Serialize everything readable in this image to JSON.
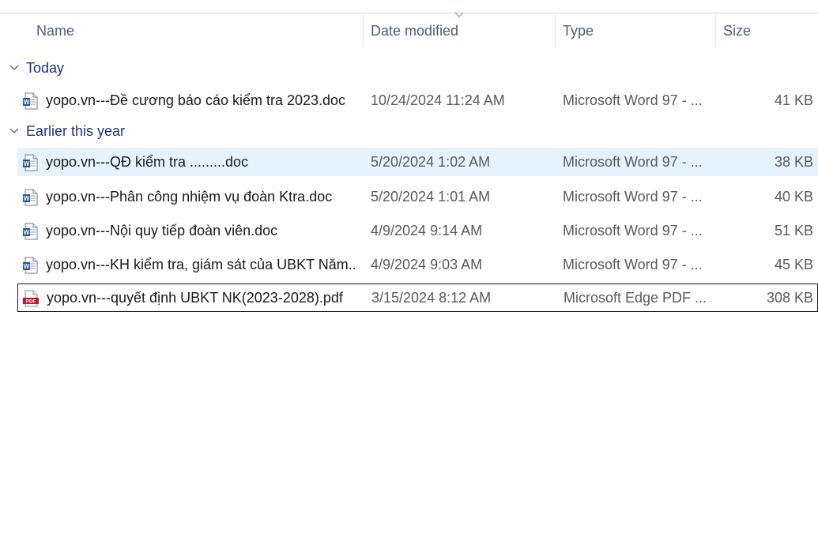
{
  "columns": {
    "name": "Name",
    "date_modified": "Date modified",
    "type": "Type",
    "size": "Size"
  },
  "groups": [
    {
      "label": "Today",
      "files": [
        {
          "name": "yopo.vn---Đề cương báo cáo kiểm tra 2023.doc",
          "date": "10/24/2024 11:24 AM",
          "type": "Microsoft Word 97 - ...",
          "size": "41 KB",
          "icon": "word-doc-icon"
        }
      ]
    },
    {
      "label": "Earlier this year",
      "files": [
        {
          "name": "yopo.vn---QĐ kiểm tra .........doc",
          "date": "5/20/2024 1:02 AM",
          "type": "Microsoft Word 97 - ...",
          "size": "38 KB",
          "icon": "word-doc-icon"
        },
        {
          "name": "yopo.vn---Phân công nhiệm vụ đoàn Ktra.doc",
          "date": "5/20/2024 1:01 AM",
          "type": "Microsoft Word 97 - ...",
          "size": "40 KB",
          "icon": "word-doc-icon"
        },
        {
          "name": "yopo.vn---Nội quy tiếp đoàn viên.doc",
          "date": "4/9/2024 9:14 AM",
          "type": "Microsoft Word 97 - ...",
          "size": "51 KB",
          "icon": "word-doc-icon"
        },
        {
          "name": "yopo.vn---KH kiểm tra, giám sát của UBKT Năm...",
          "date": "4/9/2024 9:03 AM",
          "type": "Microsoft Word 97 - ...",
          "size": "45 KB",
          "icon": "word-doc-icon"
        },
        {
          "name": "yopo.vn---quyết định UBKT NK(2023-2028).pdf",
          "date": "3/15/2024 8:12 AM",
          "type": "Microsoft Edge PDF ...",
          "size": "308 KB",
          "icon": "pdf-icon"
        }
      ]
    }
  ],
  "colors": {
    "header_text": "#4c607a",
    "group_text": "#1e3287",
    "selected_bg": "#e5f3ff",
    "pdf_red": "#c8102e",
    "word_blue": "#2b579a"
  }
}
